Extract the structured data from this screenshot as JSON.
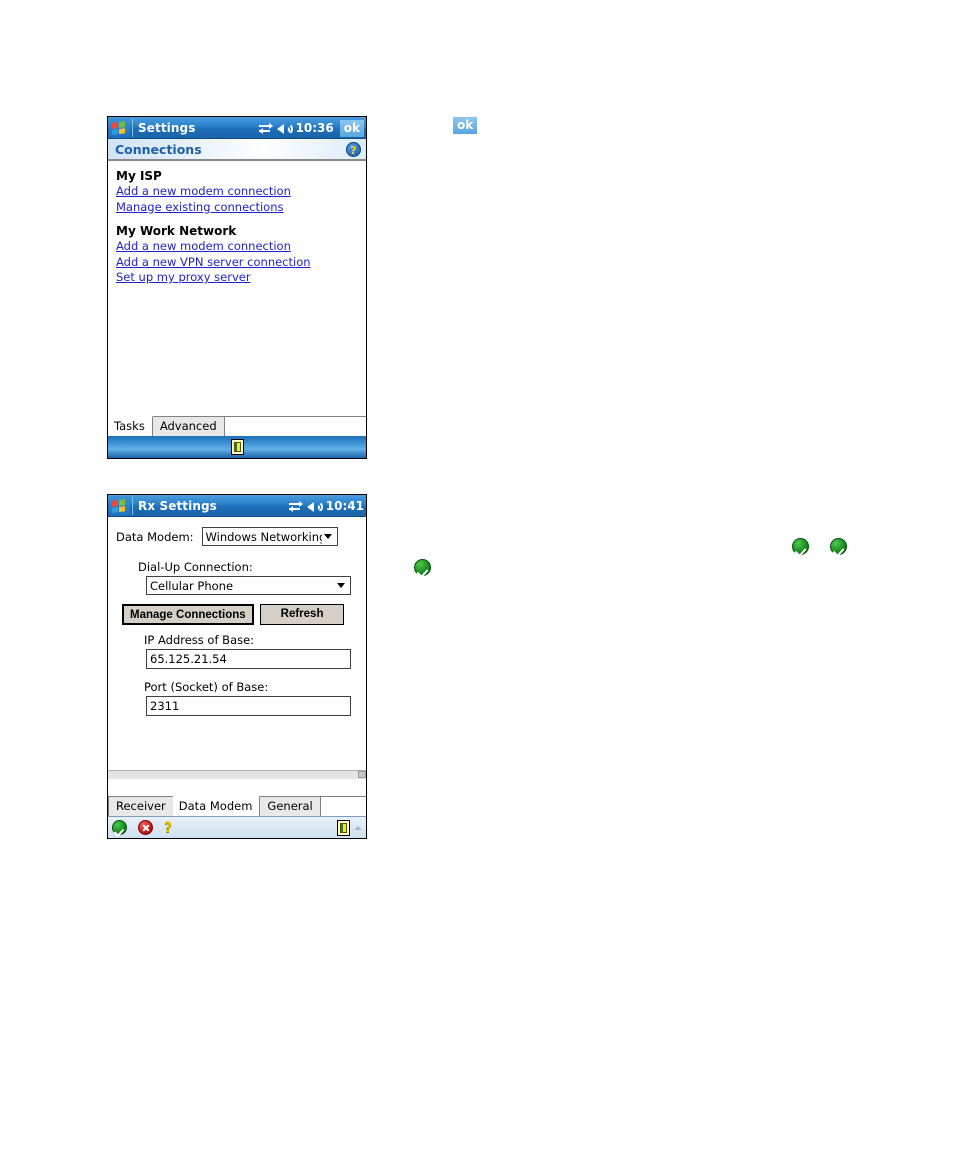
{
  "device_connections": {
    "titlebar": {
      "app_title": "Settings",
      "time": "10:36",
      "ok_label": "ok",
      "start_icon": "windows-flag-icon",
      "connectivity_icon": "connectivity-icon",
      "volume_icon": "speaker-icon"
    },
    "subheader": {
      "title": "Connections",
      "help_icon": "help-question-icon"
    },
    "groups": [
      {
        "title": "My ISP",
        "links": [
          "Add a new modem connection",
          "Manage existing connections"
        ]
      },
      {
        "title": "My Work Network",
        "links": [
          "Add a new modem connection",
          "Add a new VPN server connection",
          "Set up my proxy server"
        ]
      }
    ],
    "tabs": [
      {
        "label": "Tasks",
        "active": true
      },
      {
        "label": "Advanced",
        "active": false
      }
    ],
    "taskbar": {
      "sip_icon": "input-panel-icon"
    }
  },
  "device_rxsettings": {
    "titlebar": {
      "app_title": "Rx Settings",
      "time": "10:41",
      "start_icon": "windows-flag-icon",
      "connectivity_icon": "connectivity-icon",
      "volume_icon": "speaker-icon"
    },
    "form": {
      "data_modem_label": "Data Modem:",
      "data_modem_value": "Windows Networking",
      "dialup_label": "Dial-Up Connection:",
      "dialup_value": "Cellular Phone",
      "manage_connections_label": "Manage Connections",
      "refresh_label": "Refresh",
      "ip_label": "IP Address of Base:",
      "ip_value": "65.125.21.54",
      "port_label": "Port (Socket) of Base:",
      "port_value": "2311"
    },
    "tabs": [
      {
        "label": "Receiver",
        "active": false
      },
      {
        "label": "Data Modem",
        "active": true
      },
      {
        "label": "General",
        "active": false
      }
    ],
    "commandbar": {
      "ok_icon": "green-check-icon",
      "cancel_icon": "red-x-icon",
      "help_label": "?",
      "sip_icon": "input-panel-icon"
    }
  },
  "annotations": {
    "ok_button_label": "ok",
    "check_icon_name": "green-check-icon"
  },
  "colors": {
    "titlebar_blue": "#2a7fc9",
    "link_blue": "#2222cc",
    "subheader_text": "#1d5fa8",
    "green": "#0a7a12",
    "red": "#b10b0b",
    "help_yellow": "#e8c20b"
  }
}
